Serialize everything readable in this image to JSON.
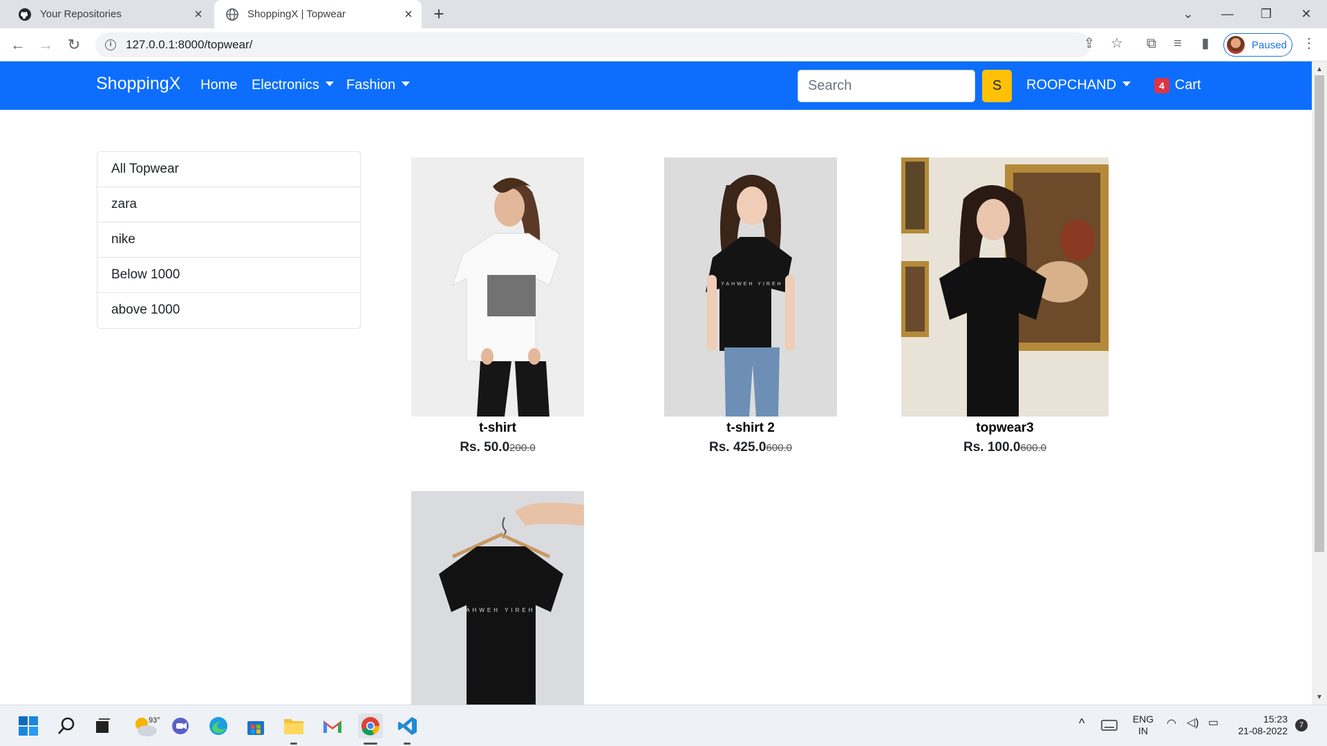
{
  "browser": {
    "tabs": [
      {
        "title": "Your Repositories",
        "icon": "github-icon"
      },
      {
        "title": "ShoppingX | Topwear",
        "icon": "globe-icon"
      }
    ],
    "url": "127.0.0.1:8000/topwear/",
    "profile_status": "Paused"
  },
  "navbar": {
    "brand": "ShoppingX",
    "links": [
      "Home",
      "Electronics",
      "Fashion"
    ],
    "search_placeholder": "Search",
    "search_button": "S",
    "user": "ROOPCHAND",
    "cart_count": "4",
    "cart_label": "Cart"
  },
  "sidebar": {
    "items": [
      "All Topwear",
      "zara",
      "nike",
      "Below 1000",
      "above 1000"
    ]
  },
  "products": [
    {
      "name": "t-shirt",
      "price": "Rs. 50.0",
      "old_price": "200.0"
    },
    {
      "name": "t-shirt 2",
      "price": "Rs. 425.0",
      "old_price": "600.0"
    },
    {
      "name": "topwear3",
      "price": "Rs. 100.0",
      "old_price": "600.0"
    },
    {
      "name": "",
      "price": "",
      "old_price": ""
    }
  ],
  "taskbar": {
    "weather": "93°",
    "language": "ENG",
    "region": "IN",
    "time": "15:23",
    "date": "21-08-2022",
    "notifications": "7"
  },
  "colors": {
    "navbar": "#0d6efd",
    "search_button": "#ffc107",
    "cart_badge": "#dc3545"
  }
}
